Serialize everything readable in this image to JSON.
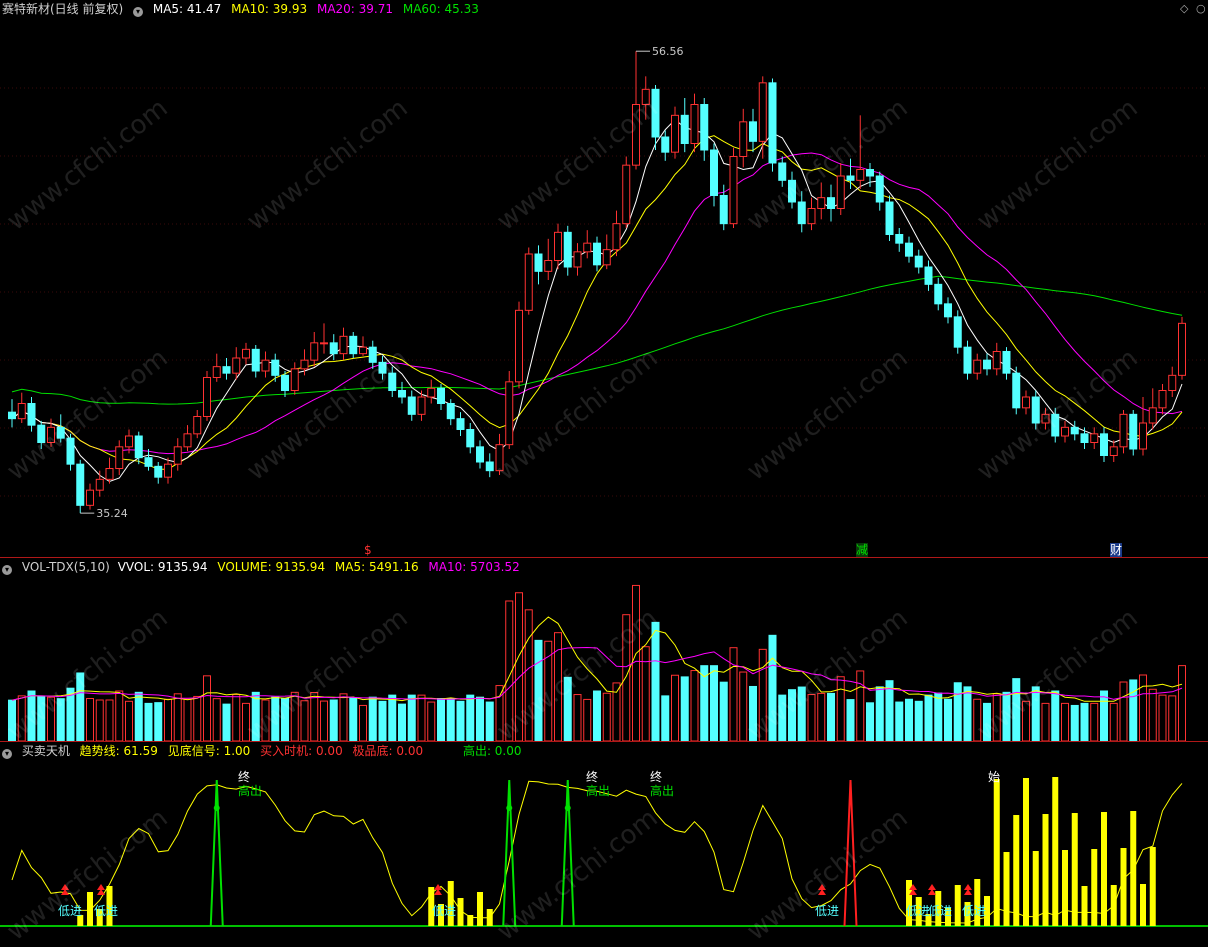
{
  "price_pane": {
    "stock_name": "赛特新材(日线 前复权)",
    "ma5": "MA5: 41.47",
    "ma10": "MA10: 39.93",
    "ma20": "MA20: 39.71",
    "ma60": "MA60: 45.33",
    "high_label": "56.56",
    "low_label": "35.24",
    "event_markers": [
      "$",
      "减",
      "财"
    ],
    "colors": {
      "up": "#ff3232",
      "down": "#54ffff",
      "ma5": "#ffffff",
      "ma10": "#ffff00",
      "ma20": "#ff00ff",
      "ma60": "#00e000"
    }
  },
  "volume_pane": {
    "title": "VOL-TDX(5,10)",
    "vvol": "VVOL: 9135.94",
    "volume": "VOLUME: 9135.94",
    "ma5": "MA5: 5491.16",
    "ma10": "MA10: 5703.52"
  },
  "indicator_pane": {
    "title": "买卖天机",
    "trend": "趋势线: 61.59",
    "bottom_signal": "见底信号: 1.00",
    "buy_time": "买入时机: 0.00",
    "extreme_bottom": "极品底: 0.00",
    "high_out": "高出: 0.00",
    "labels": {
      "low_in": "低进",
      "end": "终",
      "high_out_tag": "高出",
      "start": "始"
    }
  },
  "watermark": "www.cfchi.com",
  "toolbar": {
    "diamond_icon": "◇",
    "settings_icon": "○"
  },
  "chart_data": {
    "type": "candlestick",
    "title": "赛特新材(日线 前复权)",
    "annotations": {
      "high": 56.56,
      "low": 35.24
    },
    "ylim": [
      34,
      58
    ],
    "ma_values_last": {
      "MA5": 41.47,
      "MA10": 39.93,
      "MA20": 39.71,
      "MA60": 45.33
    },
    "candles": [
      [
        39.9,
        39.6,
        40.5,
        39.2
      ],
      [
        39.6,
        40.3,
        40.8,
        39.4
      ],
      [
        40.3,
        39.3,
        40.6,
        39.0
      ],
      [
        39.3,
        38.5,
        39.5,
        38.2
      ],
      [
        38.5,
        39.2,
        39.6,
        38.3
      ],
      [
        39.2,
        38.7,
        39.8,
        38.5
      ],
      [
        38.7,
        37.5,
        38.9,
        37.2
      ],
      [
        37.5,
        35.6,
        37.7,
        35.24
      ],
      [
        35.6,
        36.3,
        36.6,
        35.4
      ],
      [
        36.3,
        36.8,
        37.2,
        36.0
      ],
      [
        36.8,
        37.3,
        37.8,
        36.6
      ],
      [
        37.3,
        38.3,
        38.6,
        37.0
      ],
      [
        38.3,
        38.8,
        39.1,
        38.0
      ],
      [
        38.8,
        37.8,
        39.0,
        37.5
      ],
      [
        37.8,
        37.4,
        38.2,
        37.2
      ],
      [
        37.4,
        36.9,
        37.6,
        36.6
      ],
      [
        36.9,
        37.5,
        37.8,
        36.6
      ],
      [
        37.5,
        38.3,
        38.7,
        37.2
      ],
      [
        38.3,
        38.9,
        39.3,
        38.1
      ],
      [
        38.9,
        39.7,
        40.0,
        38.7
      ],
      [
        39.7,
        41.5,
        41.8,
        39.5
      ],
      [
        41.5,
        42.0,
        42.6,
        41.3
      ],
      [
        42.0,
        41.7,
        42.4,
        41.4
      ],
      [
        41.7,
        42.4,
        42.9,
        41.4
      ],
      [
        42.4,
        42.8,
        43.1,
        42.1
      ],
      [
        42.8,
        41.8,
        43.0,
        41.5
      ],
      [
        41.8,
        42.3,
        42.7,
        41.5
      ],
      [
        42.3,
        41.6,
        42.6,
        41.3
      ],
      [
        41.6,
        40.9,
        41.8,
        40.6
      ],
      [
        40.9,
        41.9,
        42.2,
        40.7
      ],
      [
        41.9,
        42.3,
        42.8,
        41.6
      ],
      [
        42.3,
        43.1,
        43.6,
        42.0
      ],
      [
        43.1,
        43.1,
        44.0,
        42.6
      ],
      [
        43.1,
        42.6,
        43.5,
        42.3
      ],
      [
        42.6,
        43.4,
        43.8,
        42.3
      ],
      [
        43.4,
        42.6,
        43.6,
        42.4
      ],
      [
        42.6,
        42.9,
        43.4,
        42.5
      ],
      [
        42.9,
        42.2,
        43.2,
        41.9
      ],
      [
        42.2,
        41.7,
        42.5,
        41.4
      ],
      [
        41.7,
        40.9,
        42.0,
        40.6
      ],
      [
        40.9,
        40.6,
        41.3,
        40.3
      ],
      [
        40.6,
        39.8,
        40.9,
        39.5
      ],
      [
        39.8,
        40.6,
        40.9,
        39.5
      ],
      [
        40.6,
        41.0,
        41.4,
        40.3
      ],
      [
        41.0,
        40.3,
        41.2,
        40.0
      ],
      [
        40.3,
        39.6,
        40.5,
        39.3
      ],
      [
        39.6,
        39.1,
        39.9,
        38.8
      ],
      [
        39.1,
        38.3,
        39.4,
        38.0
      ],
      [
        38.3,
        37.6,
        38.6,
        37.3
      ],
      [
        37.6,
        37.2,
        38.0,
        36.9
      ],
      [
        37.2,
        38.4,
        38.9,
        37.0
      ],
      [
        38.4,
        41.3,
        41.8,
        38.2
      ],
      [
        41.3,
        44.6,
        45.0,
        41.0
      ],
      [
        44.6,
        47.2,
        47.5,
        44.4
      ],
      [
        47.2,
        46.4,
        47.6,
        45.8
      ],
      [
        46.4,
        46.9,
        47.9,
        46.0
      ],
      [
        46.9,
        48.2,
        48.6,
        46.5
      ],
      [
        48.2,
        46.6,
        48.5,
        46.2
      ],
      [
        46.6,
        47.3,
        47.7,
        46.2
      ],
      [
        47.3,
        47.7,
        48.3,
        47.0
      ],
      [
        47.7,
        46.7,
        48.0,
        46.4
      ],
      [
        46.7,
        47.4,
        48.1,
        46.5
      ],
      [
        47.4,
        48.6,
        49.2,
        47.1
      ],
      [
        48.6,
        51.3,
        51.7,
        48.4
      ],
      [
        51.3,
        54.1,
        56.56,
        51.1
      ],
      [
        54.1,
        54.8,
        55.4,
        53.4
      ],
      [
        54.8,
        52.6,
        55.0,
        52.0
      ],
      [
        52.6,
        51.9,
        52.9,
        51.5
      ],
      [
        51.9,
        53.6,
        54.0,
        51.6
      ],
      [
        53.6,
        52.3,
        54.4,
        51.9
      ],
      [
        52.3,
        54.1,
        54.6,
        51.9
      ],
      [
        54.1,
        52.0,
        54.4,
        51.5
      ],
      [
        52.0,
        49.9,
        52.3,
        49.4
      ],
      [
        49.9,
        48.6,
        50.4,
        48.3
      ],
      [
        48.6,
        51.7,
        52.1,
        48.4
      ],
      [
        51.7,
        53.3,
        53.9,
        51.2
      ],
      [
        53.3,
        52.4,
        53.9,
        51.9
      ],
      [
        52.4,
        55.1,
        55.4,
        51.6
      ],
      [
        55.1,
        51.4,
        55.3,
        51.0
      ],
      [
        51.4,
        50.6,
        51.7,
        50.3
      ],
      [
        50.6,
        49.6,
        51.0,
        49.3
      ],
      [
        49.6,
        48.6,
        50.1,
        48.2
      ],
      [
        48.6,
        49.3,
        49.8,
        48.3
      ],
      [
        49.3,
        49.8,
        50.5,
        48.8
      ],
      [
        49.8,
        49.3,
        50.4,
        48.7
      ],
      [
        49.3,
        50.8,
        51.4,
        49.0
      ],
      [
        50.8,
        50.6,
        51.6,
        50.2
      ],
      [
        50.6,
        51.1,
        53.6,
        50.2
      ],
      [
        51.1,
        50.8,
        51.4,
        50.3
      ],
      [
        50.8,
        49.6,
        51.0,
        49.2
      ],
      [
        49.6,
        48.1,
        49.9,
        47.8
      ],
      [
        48.1,
        47.7,
        48.4,
        47.3
      ],
      [
        47.7,
        47.1,
        48.0,
        46.8
      ],
      [
        47.1,
        46.6,
        47.4,
        46.3
      ],
      [
        46.6,
        45.8,
        46.9,
        45.5
      ],
      [
        45.8,
        44.9,
        46.1,
        44.6
      ],
      [
        44.9,
        44.3,
        45.2,
        44.0
      ],
      [
        44.3,
        42.9,
        44.6,
        42.6
      ],
      [
        42.9,
        41.7,
        43.2,
        41.4
      ],
      [
        41.7,
        42.3,
        42.6,
        41.4
      ],
      [
        42.3,
        41.9,
        42.6,
        41.6
      ],
      [
        41.9,
        42.7,
        43.1,
        41.6
      ],
      [
        42.7,
        41.7,
        42.9,
        41.4
      ],
      [
        41.7,
        40.1,
        42.0,
        39.8
      ],
      [
        40.1,
        40.6,
        40.9,
        39.8
      ],
      [
        40.6,
        39.4,
        40.9,
        39.1
      ],
      [
        39.4,
        39.8,
        40.1,
        39.1
      ],
      [
        39.8,
        38.8,
        40.1,
        38.5
      ],
      [
        38.8,
        39.2,
        39.5,
        38.5
      ],
      [
        39.2,
        38.9,
        39.5,
        38.6
      ],
      [
        38.9,
        38.5,
        39.2,
        38.2
      ],
      [
        38.5,
        38.9,
        39.2,
        38.2
      ],
      [
        38.9,
        37.9,
        39.2,
        37.6
      ],
      [
        37.9,
        38.3,
        38.6,
        37.6
      ],
      [
        38.3,
        39.8,
        40.0,
        38.0
      ],
      [
        39.8,
        38.2,
        40.0,
        37.9
      ],
      [
        38.2,
        39.4,
        40.6,
        37.9
      ],
      [
        39.4,
        40.1,
        41.0,
        39.1
      ],
      [
        40.1,
        40.9,
        41.2,
        39.8
      ],
      [
        40.9,
        41.6,
        42.0,
        40.6
      ],
      [
        41.6,
        44.0,
        44.3,
        41.4
      ]
    ]
  }
}
